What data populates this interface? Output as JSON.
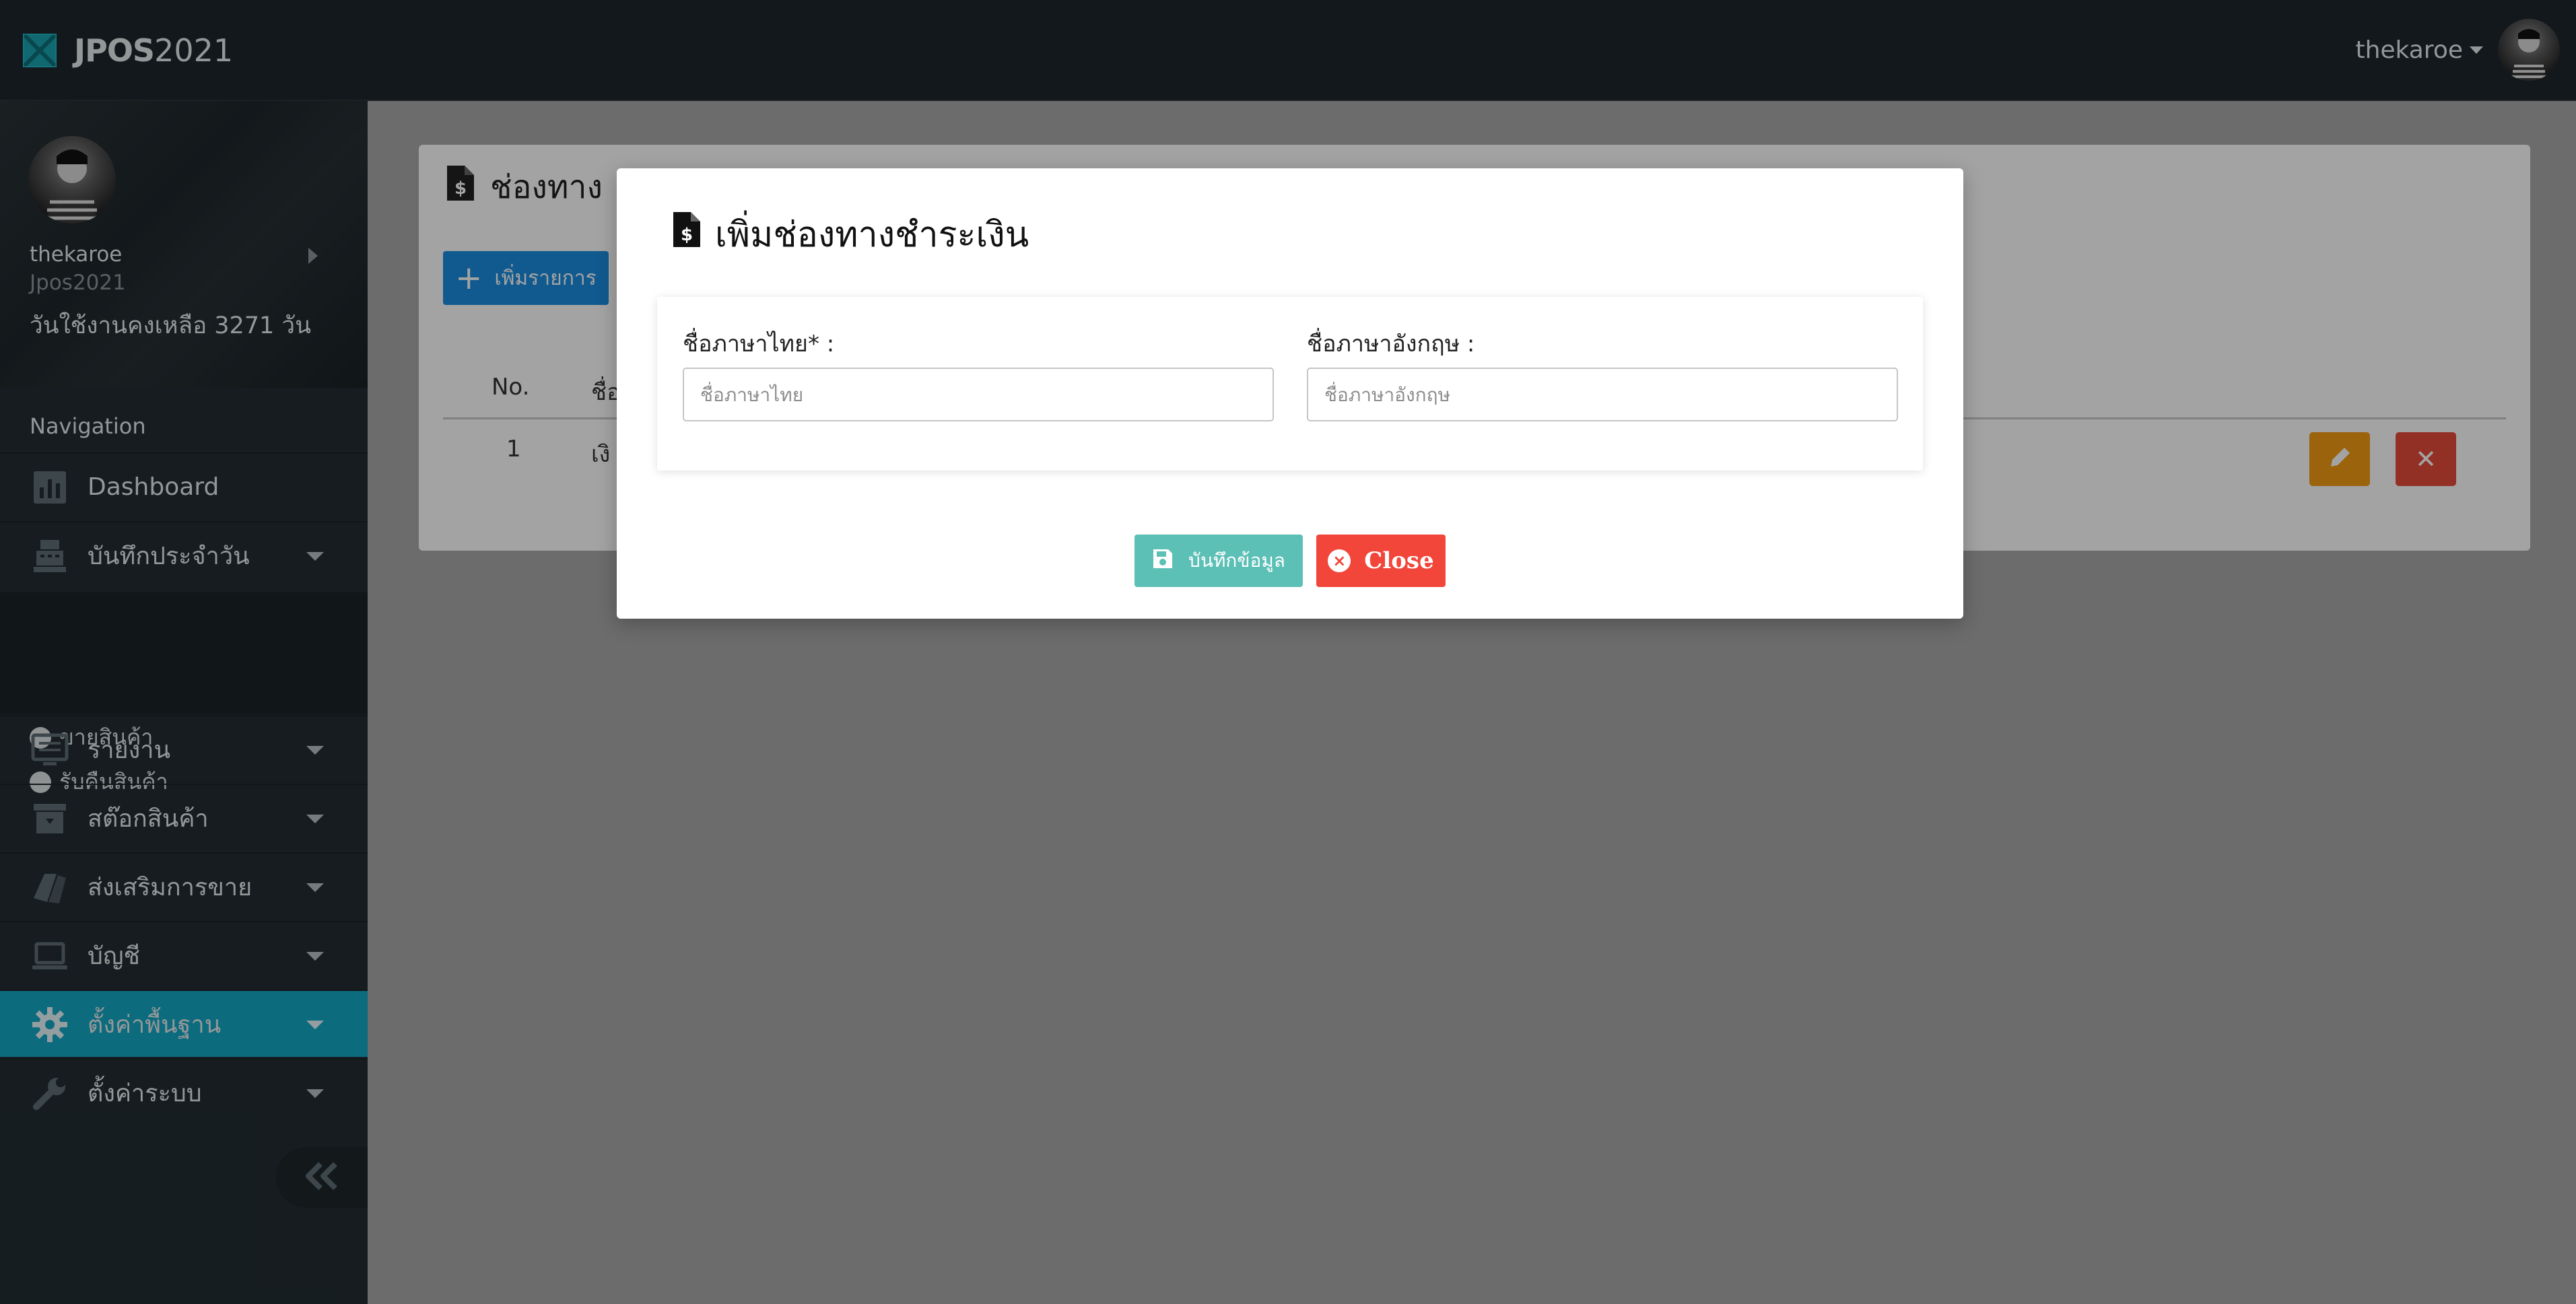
{
  "app": {
    "brand_bold": "JPOS",
    "brand_year": "2021"
  },
  "topbar": {
    "username": "thekaroe"
  },
  "sidebar": {
    "profile": {
      "name": "thekaroe",
      "role": "Jpos2021",
      "days_left": "วันใช้งานคงเหลือ 3271 วัน"
    },
    "nav_header": "Navigation",
    "items": [
      {
        "label": "Dashboard",
        "icon": "chart-icon"
      },
      {
        "label": "บันทึกประจำวัน",
        "icon": "cash-register-icon"
      },
      {
        "label": "รายงาน",
        "icon": "monitor-icon"
      },
      {
        "label": "สต๊อกสินค้า",
        "icon": "archive-icon"
      },
      {
        "label": "ส่งเสริมการขาย",
        "icon": "tags-icon"
      },
      {
        "label": "บัญชี",
        "icon": "laptop-icon"
      },
      {
        "label": "ตั้งค่าพื้นฐาน",
        "icon": "gear-icon",
        "active": true
      },
      {
        "label": "ตั้งค่าระบบ",
        "icon": "wrench-icon"
      }
    ],
    "sub_items": [
      {
        "label": "ขายสินค้า"
      },
      {
        "label": "รับคืนสินค้า"
      }
    ]
  },
  "page": {
    "title": "ช่องทาง",
    "add_button": "เพิ่มรายการ",
    "table": {
      "headers": [
        "No.",
        "ชื่อ"
      ],
      "rows": [
        {
          "no": "1",
          "name": "เงิ"
        }
      ]
    }
  },
  "modal": {
    "title": "เพิ่มช่องทางชำระเงิน",
    "thai_label": "ชื่อภาษาไทย* :",
    "thai_placeholder": "ชื่อภาษาไทย",
    "thai_value": "",
    "en_label": "ชื่อภาษาอังกฤษ :",
    "en_placeholder": "ชื่อภาษาอังกฤษ",
    "en_value": "",
    "save_button": "บันทึกข้อมูล",
    "close_button": "Close"
  },
  "colors": {
    "topbar": "#1e272c",
    "sidebar": "#232d32",
    "active_nav": "#14a8c4",
    "primary_button": "#1c8ee0",
    "save_button": "#5cc0b6",
    "close_button": "#f2463b",
    "edit_button": "#f39c12",
    "delete_button": "#e74c3c"
  }
}
